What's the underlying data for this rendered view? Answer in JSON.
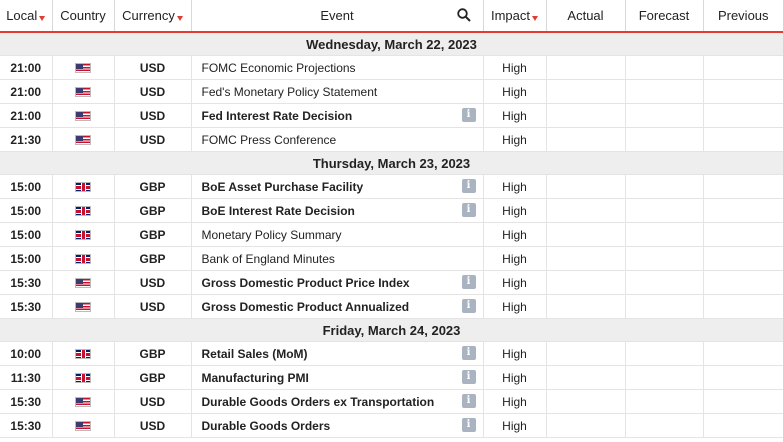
{
  "header": {
    "local": "Local",
    "country": "Country",
    "currency": "Currency",
    "event": "Event",
    "impact": "Impact",
    "actual": "Actual",
    "forecast": "Forecast",
    "previous": "Previous"
  },
  "colors": {
    "accent": "#e03c31",
    "date_row_bg": "#eeeeee",
    "info_icon": "#aab4c0"
  },
  "groups": [
    {
      "date": "Wednesday, March 22, 2023",
      "rows": [
        {
          "time": "21:00",
          "flag": "us-flag-icon",
          "currency": "USD",
          "event": "FOMC Economic Projections",
          "bold": false,
          "info": false,
          "impact": "High"
        },
        {
          "time": "21:00",
          "flag": "us-flag-icon",
          "currency": "USD",
          "event": "Fed's Monetary Policy Statement",
          "bold": false,
          "info": false,
          "impact": "High"
        },
        {
          "time": "21:00",
          "flag": "us-flag-icon",
          "currency": "USD",
          "event": "Fed Interest Rate Decision",
          "bold": true,
          "info": true,
          "impact": "High"
        },
        {
          "time": "21:30",
          "flag": "us-flag-icon",
          "currency": "USD",
          "event": "FOMC Press Conference",
          "bold": false,
          "info": false,
          "impact": "High"
        }
      ]
    },
    {
      "date": "Thursday, March 23, 2023",
      "rows": [
        {
          "time": "15:00",
          "flag": "uk-flag-icon",
          "currency": "GBP",
          "event": "BoE Asset Purchase Facility",
          "bold": true,
          "info": true,
          "impact": "High"
        },
        {
          "time": "15:00",
          "flag": "uk-flag-icon",
          "currency": "GBP",
          "event": "BoE Interest Rate Decision",
          "bold": true,
          "info": true,
          "impact": "High"
        },
        {
          "time": "15:00",
          "flag": "uk-flag-icon",
          "currency": "GBP",
          "event": "Monetary Policy Summary",
          "bold": false,
          "info": false,
          "impact": "High"
        },
        {
          "time": "15:00",
          "flag": "uk-flag-icon",
          "currency": "GBP",
          "event": "Bank of England Minutes",
          "bold": false,
          "info": false,
          "impact": "High"
        },
        {
          "time": "15:30",
          "flag": "us-flag-icon",
          "currency": "USD",
          "event": "Gross Domestic Product Price Index",
          "bold": true,
          "info": true,
          "impact": "High"
        },
        {
          "time": "15:30",
          "flag": "us-flag-icon",
          "currency": "USD",
          "event": "Gross Domestic Product Annualized",
          "bold": true,
          "info": true,
          "impact": "High"
        }
      ]
    },
    {
      "date": "Friday, March 24, 2023",
      "rows": [
        {
          "time": "10:00",
          "flag": "uk-flag-icon",
          "currency": "GBP",
          "event": "Retail Sales (MoM)",
          "bold": true,
          "info": true,
          "impact": "High"
        },
        {
          "time": "11:30",
          "flag": "uk-flag-icon",
          "currency": "GBP",
          "event": "Manufacturing PMI",
          "bold": true,
          "info": true,
          "impact": "High"
        },
        {
          "time": "15:30",
          "flag": "us-flag-icon",
          "currency": "USD",
          "event": "Durable Goods Orders ex Transportation",
          "bold": true,
          "info": true,
          "impact": "High"
        },
        {
          "time": "15:30",
          "flag": "us-flag-icon",
          "currency": "USD",
          "event": "Durable Goods Orders",
          "bold": true,
          "info": true,
          "impact": "High"
        }
      ]
    }
  ]
}
